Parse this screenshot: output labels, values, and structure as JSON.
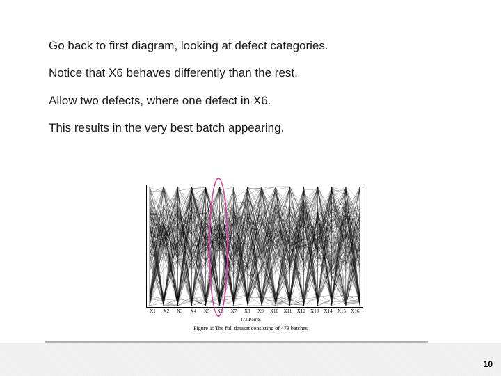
{
  "paragraphs": {
    "p1": "Go back to first diagram, looking at defect categories.",
    "p2": "Notice that X6 behaves differently than the rest.",
    "p3": "Allow two defects, where one defect in X6.",
    "p4": "This results in the very best batch appearing."
  },
  "figure": {
    "axis_labels": [
      "X1",
      "X2",
      "X3",
      "X4",
      "X5",
      "X6",
      "X7",
      "X8",
      "X9",
      "X10",
      "X11",
      "X12",
      "X13",
      "X14",
      "X15",
      "X16"
    ],
    "subcaption": "473 Points",
    "caption": "Figure 1: The full dataset consisting of 473 batches"
  },
  "highlight": {
    "color": "#d8409a"
  },
  "page_number": "10"
}
